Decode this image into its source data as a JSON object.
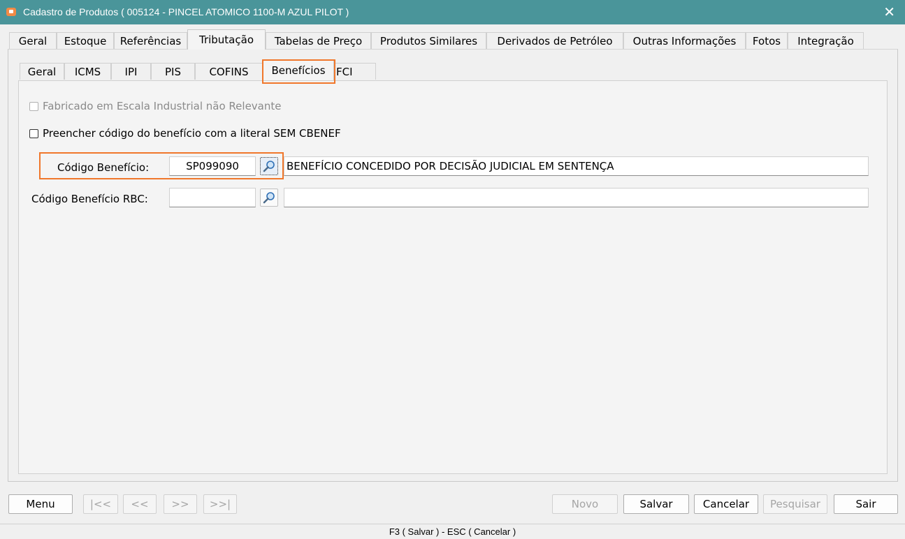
{
  "window": {
    "title": "Cadastro de Produtos ( 005124 - PINCEL ATOMICO 1100-M AZUL PILOT )",
    "close": "✕"
  },
  "main_tabs": {
    "geral": "Geral",
    "estoque": "Estoque",
    "referencias": "Referências",
    "tributacao": "Tributação",
    "tabelas_preco": "Tabelas de Preço",
    "produtos_similares": "Produtos Similares",
    "derivados": "Derivados de Petróleo",
    "outras": "Outras Informações",
    "fotos": "Fotos",
    "integracao": "Integração",
    "active": "Tributação"
  },
  "sub_tabs": {
    "geral": "Geral",
    "icms": "ICMS",
    "ipi": "IPI",
    "pis": "PIS",
    "cofins": "COFINS",
    "beneficios": "Benefícios",
    "fci": "FCI",
    "active": "Benefícios"
  },
  "form": {
    "chk_escala": {
      "label": "Fabricado em Escala Industrial não Relevante",
      "checked": false,
      "enabled": false
    },
    "chk_literal": {
      "label": "Preencher código do benefício com a literal SEM CBENEF",
      "checked": false,
      "enabled": true
    },
    "codigo_beneficio": {
      "label": "Código Benefício:",
      "code": "SP099090",
      "description": "BENEFÍCIO CONCEDIDO POR DECISÃO JUDICIAL EM SENTENÇA"
    },
    "codigo_beneficio_rbc": {
      "label": "Código Benefício RBC:",
      "code": "",
      "description": ""
    }
  },
  "buttons": {
    "menu": "Menu",
    "first": "|<<",
    "prev": "<<",
    "next": ">>",
    "last": ">>|",
    "novo": "Novo",
    "salvar": "Salvar",
    "cancelar": "Cancelar",
    "pesquisar": "Pesquisar",
    "sair": "Sair"
  },
  "status": "F3 ( Salvar )  -  ESC ( Cancelar )",
  "colors": {
    "titlebar": "#4a959a",
    "highlight": "#f0772b",
    "app_icon": "#f28a45"
  },
  "icons": {
    "search": "magnifier-icon"
  }
}
